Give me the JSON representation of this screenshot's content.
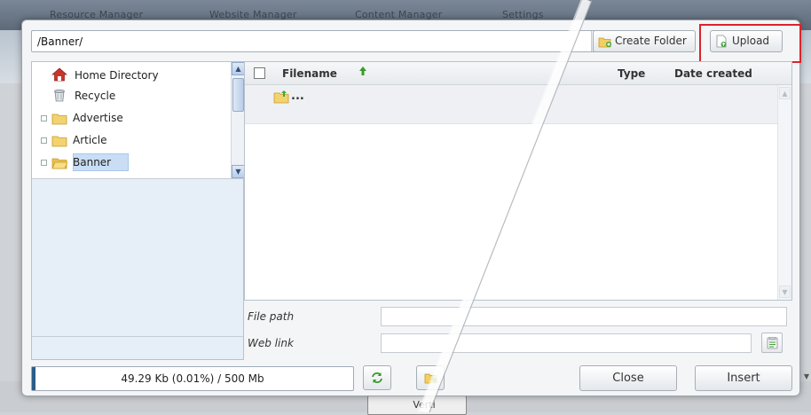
{
  "background": {
    "menu_items": [
      "Resource Manager",
      "Website Manager",
      "Content Manager",
      "Settings"
    ],
    "partial_button_label": "Verti"
  },
  "toolbar": {
    "path_value": "/Banner/",
    "create_folder_label": "Create Folder",
    "upload_label": "Upload"
  },
  "tree": {
    "items": [
      {
        "label": "Home Directory",
        "icon": "home-icon"
      },
      {
        "label": "Recycle",
        "icon": "recycle-bin-icon"
      },
      {
        "label": "Advertise",
        "icon": "folder-icon"
      },
      {
        "label": "Article",
        "icon": "folder-icon"
      },
      {
        "label": "Banner",
        "icon": "folder-open-icon",
        "selected": true
      }
    ]
  },
  "file_list": {
    "columns": [
      "Filename",
      "Type",
      "Date created"
    ],
    "sort_column": "Filename",
    "sort_direction": "ascending",
    "up_row_label": "..."
  },
  "properties": {
    "file_path_label": "File path",
    "web_link_label": "Web link",
    "file_path_value": "",
    "web_link_value": ""
  },
  "quota": {
    "text": "49.29 Kb (0.01%) / 500 Mb",
    "used_percent": 0.01
  },
  "buttons": {
    "close": "Close",
    "insert": "Insert"
  },
  "colors": {
    "highlight_box": "#d9242d",
    "selected_item": "#c9def5",
    "quota_fill": "#2a5d8a"
  }
}
